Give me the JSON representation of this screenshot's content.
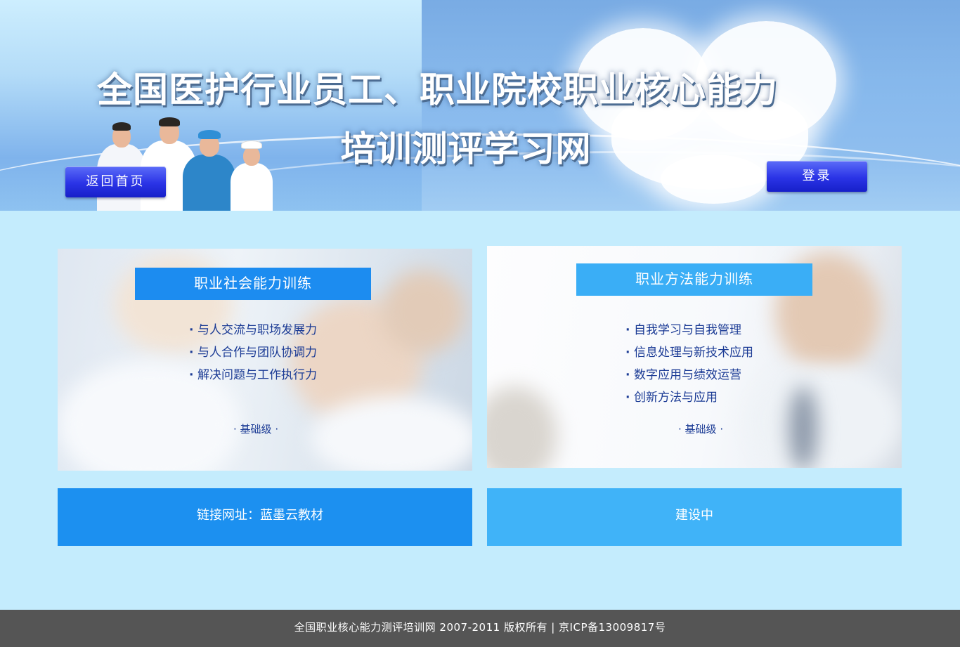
{
  "banner": {
    "title_line1": "全国医护行业员工、职业院校职业核心能力",
    "title_line2": "培训测评学习网",
    "home_button": "返回首页",
    "login_button": "登录"
  },
  "cards": [
    {
      "header": "职业社会能力训练",
      "items": [
        "与人交流与职场发展力",
        "与人合作与团队协调力",
        "解决问题与工作执行力"
      ],
      "level": "基础级"
    },
    {
      "header": "职业方法能力训练",
      "items": [
        "自我学习与自我管理",
        "信息处理与新技术应用",
        "数字应用与绩效运营",
        "创新方法与应用"
      ],
      "level": "基础级"
    }
  ],
  "links": {
    "left": "链接网址：蓝墨云教材",
    "right": "建设中"
  },
  "footer": {
    "text": "全国职业核心能力测评培训网 2007-2011 版权所有 | 京ICP备13009817号"
  },
  "colors": {
    "page_bg": "#c4ecfd",
    "accent_dark": "#1c8cf0",
    "accent_light": "#3aaef6",
    "button": "#2a33e6",
    "footer_bg": "#555555",
    "list_text": "#1b3b95"
  }
}
